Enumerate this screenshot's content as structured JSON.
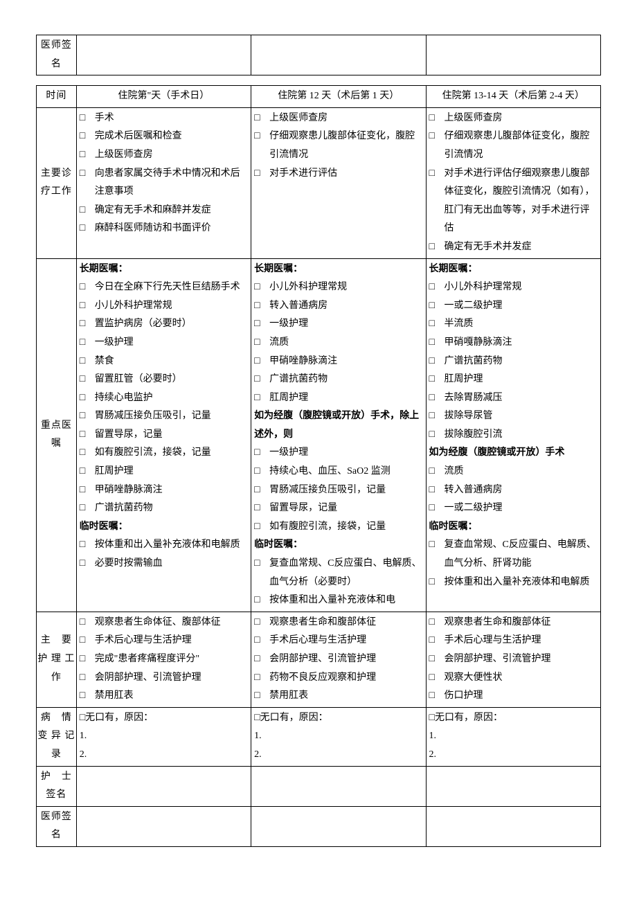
{
  "top_table": {
    "row_label": "医师签名"
  },
  "main_table": {
    "row_time_label": "时间",
    "col1_header": "住院第\"天（手术日）",
    "col2_header": "住院第 12 天（术后第 1 天）",
    "col3_header": "住院第 13-14 天（术后第 2-4 天）",
    "row_work_label": "主要诊疗工作",
    "work": {
      "c1": [
        "手术",
        "完成术后医嘱和检查",
        "上级医师查房",
        "向患者家属交待手术中情况和术后注意事项",
        "确定有无手术和麻醉并发症",
        "麻醉科医师随访和书面评价"
      ],
      "c2": [
        "上级医师查房",
        "仔细观察患儿腹部体征变化，腹腔引流情况",
        "对手术进行评估"
      ],
      "c3": [
        "上级医师查房",
        "仔细观察患儿腹部体征变化，腹腔引流情况",
        "对手术进行评估仔细观察患儿腹部体征变化，腹腔引流情况（如有），肛门有无出血等等，对手术进行评估",
        "确定有无手术并发症"
      ]
    },
    "row_orders_label": "重点医嘱",
    "orders": {
      "c1": {
        "h1": "长期医嘱：",
        "g1": [
          "今日在全麻下行先天性巨结肠手术",
          "小儿外科护理常规",
          "置监护病房（必要时）",
          "一级护理",
          "禁食",
          "留置肛管（必要时）",
          "持续心电监护",
          "胃肠减压接负压吸引，记量",
          "留置导尿，记量",
          "如有腹腔引流，接袋，记量",
          "肛周护理",
          "甲硝唑静脉滴注",
          "广谱抗菌药物"
        ],
        "h2": "临时医嘱：",
        "g2": [
          "按体重和出入量补充液体和电解质",
          "必要时按需输血"
        ]
      },
      "c2": {
        "h1": "长期医嘱：",
        "g1": [
          "小儿外科护理常规",
          "转入普通病房",
          "一级护理",
          "流质",
          "甲硝唑静脉滴注",
          "广谱抗菌药物",
          "肛周护理"
        ],
        "h2": "如为经腹（腹腔镜或开放）手术，除上述外，则",
        "g2": [
          "一级护理",
          "持续心电、血压、SaO2 监测",
          "胃肠减压接负压吸引，记量",
          "留置导尿，记量",
          "如有腹腔引流，接袋，记量"
        ],
        "h3": "临时医嘱：",
        "g3": [
          "复查血常规、C反应蛋白、电解质、血气分析（必要时）",
          "按体重和出入量补充液体和电"
        ]
      },
      "c3": {
        "h1": "长期医嘱：",
        "g1": [
          "小儿外科护理常规",
          "一或二级护理",
          "半流质",
          "甲硝嘎静脉滴注",
          "广谱抗菌药物",
          "肛周护理",
          "去除胃肠减压",
          "拔除导尿管",
          "拔除腹腔引流"
        ],
        "h2": "如为经腹（腹腔镜或开放）手术",
        "g2": [
          "流质",
          "转入普通病房",
          "一或二级护理"
        ],
        "h3": "临时医嘱：",
        "g3": [
          "复查血常规、C反应蛋白、电解质、血气分析、肝肾功能",
          "按体重和出入量补充液体和电解质"
        ]
      }
    },
    "row_nursing_label": "主　要护 理 工作",
    "nursing": {
      "c1": [
        "观察患者生命体征、腹部体征",
        "手术后心理与生活护理",
        "完成\"患者疼痛程度评分\"",
        "会阴部护理、引流管护理",
        "禁用肛表"
      ],
      "c2": [
        "观察患者生命和腹部体征",
        "手术后心理与生活护理",
        "会阴部护理、引流管护理",
        "药物不良反应观察和护理",
        "禁用肛表"
      ],
      "c3": [
        "观察患者生命和腹部体征",
        "手术后心理与生活护理",
        "会阴部护理、引流管护理",
        "观察大便性状",
        "伤口护理"
      ]
    },
    "row_variance_label": "病　情变 异 记录",
    "variance_text": "无口有，原因：",
    "variance_lines": [
      "1.",
      "2."
    ],
    "row_nurse_sig_label": "护　士签名",
    "row_doctor_sig_label": "医师签名"
  },
  "checkbox_glyph": "□"
}
